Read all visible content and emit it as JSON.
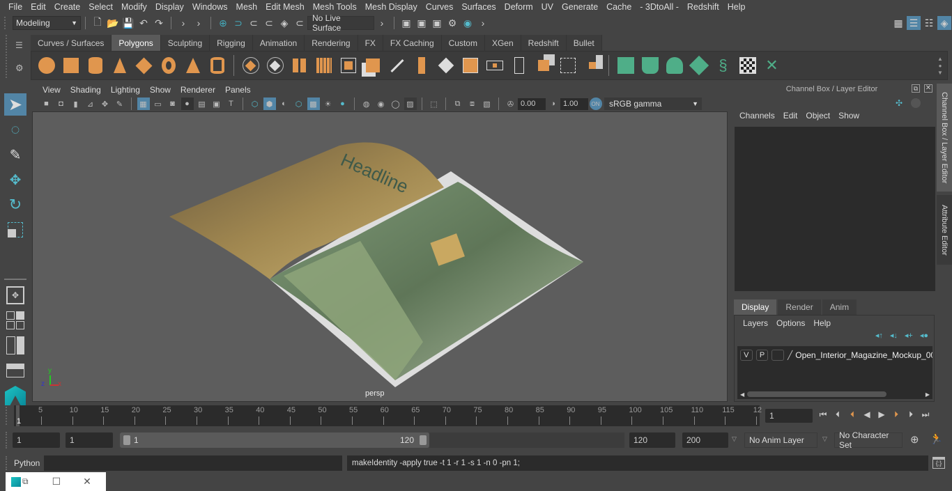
{
  "menubar": {
    "items": [
      "File",
      "Edit",
      "Create",
      "Select",
      "Modify",
      "Display",
      "Windows",
      "Mesh",
      "Edit Mesh",
      "Mesh Tools",
      "Mesh Display",
      "Curves",
      "Surfaces",
      "Deform",
      "UV",
      "Generate",
      "Cache",
      "- 3DtoAll -",
      "Redshift",
      "Help"
    ]
  },
  "statusline": {
    "mode": "Modeling",
    "live_surface": "No Live Surface"
  },
  "shelf": {
    "tabs": [
      "Curves / Surfaces",
      "Polygons",
      "Sculpting",
      "Rigging",
      "Animation",
      "Rendering",
      "FX",
      "FX Caching",
      "Custom",
      "XGen",
      "Redshift",
      "Bullet"
    ],
    "active_tab": "Polygons",
    "tools": [
      "poly-sphere",
      "poly-cube",
      "poly-cylinder",
      "poly-cone",
      "poly-plane",
      "poly-torus",
      "poly-pyramid",
      "poly-pipe",
      "combine",
      "separate",
      "mirror",
      "smooth",
      "extrude",
      "bevel",
      "multi-cut",
      "bridge",
      "boolean",
      "append",
      "edge-loop",
      "insert-loop",
      "offset-edge",
      "fill-hole",
      "merge",
      "extract",
      "uv-planar",
      "uv-cylindrical",
      "uv-spherical",
      "uv-automatic",
      "uv-contour",
      "uv-editor",
      "uv-unfold"
    ]
  },
  "viewport": {
    "menu": [
      "View",
      "Shading",
      "Lighting",
      "Show",
      "Renderer",
      "Panels"
    ],
    "exposure": "0.00",
    "gamma": "1.00",
    "color_space": "sRGB gamma",
    "camera_label": "persp",
    "scene_headline": "Headline",
    "axis": {
      "x": "x",
      "y": "y",
      "z": "z"
    }
  },
  "right_panel": {
    "title": "Channel Box / Layer Editor",
    "menu": [
      "Channels",
      "Edit",
      "Object",
      "Show"
    ],
    "layer_tabs": [
      "Display",
      "Render",
      "Anim"
    ],
    "active_layer_tab": "Display",
    "layer_menu": [
      "Layers",
      "Options",
      "Help"
    ],
    "layers": [
      {
        "v": "V",
        "p": "P",
        "name": "Open_Interior_Magazine_Mockup_00"
      }
    ],
    "side_tabs": [
      "Channel Box / Layer Editor",
      "Attribute Editor"
    ]
  },
  "timeline": {
    "ticks": [
      "5",
      "10",
      "15",
      "20",
      "25",
      "30",
      "35",
      "40",
      "45",
      "50",
      "55",
      "60",
      "65",
      "70",
      "75",
      "80",
      "85",
      "90",
      "95",
      "100",
      "105",
      "110",
      "115",
      "12"
    ],
    "current_frame_marker": "1",
    "current_frame": "1"
  },
  "range": {
    "start": "1",
    "playback_start": "1",
    "slider_start": "1",
    "slider_end": "120",
    "playback_end": "120",
    "end": "200",
    "anim_layer": "No Anim Layer",
    "character_set": "No Character Set"
  },
  "command": {
    "language": "Python",
    "input": "",
    "output": "makeIdentity -apply true -t 1 -r 1 -s 1 -n 0 -pn 1;"
  }
}
